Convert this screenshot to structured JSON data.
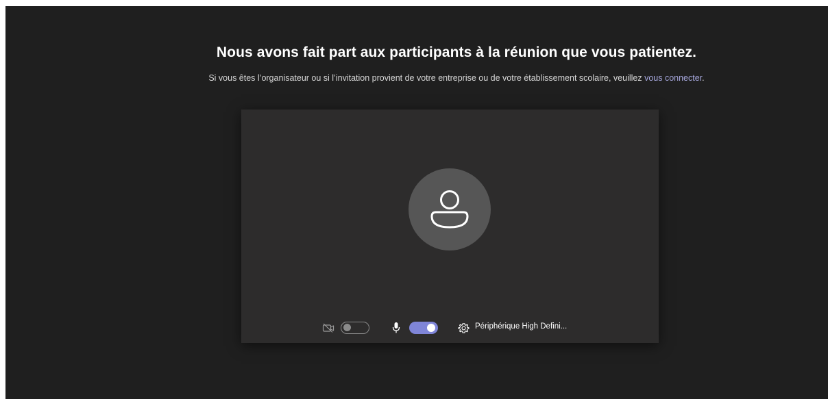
{
  "header": {
    "title": "Nous avons fait part aux participants à la réunion que vous patientez.",
    "subtitle": "Si vous êtes l’organisateur ou si l’invitation provient de votre entreprise ou de votre établissement scolaire, veuillez ",
    "signin_link": "vous connecter",
    "subtitle_end": "."
  },
  "preview": {
    "avatar_icon": "person-icon",
    "camera": {
      "icon": "camera-off-icon",
      "enabled": false
    },
    "microphone": {
      "icon": "microphone-icon",
      "enabled": true
    },
    "device": {
      "icon": "gear-icon",
      "label": "Périphérique High Defini..."
    }
  },
  "colors": {
    "background": "#1f1f1f",
    "panel": "#2d2c2c",
    "avatar": "#565656",
    "accent": "#7f85d8",
    "link": "#a6a7dc"
  }
}
